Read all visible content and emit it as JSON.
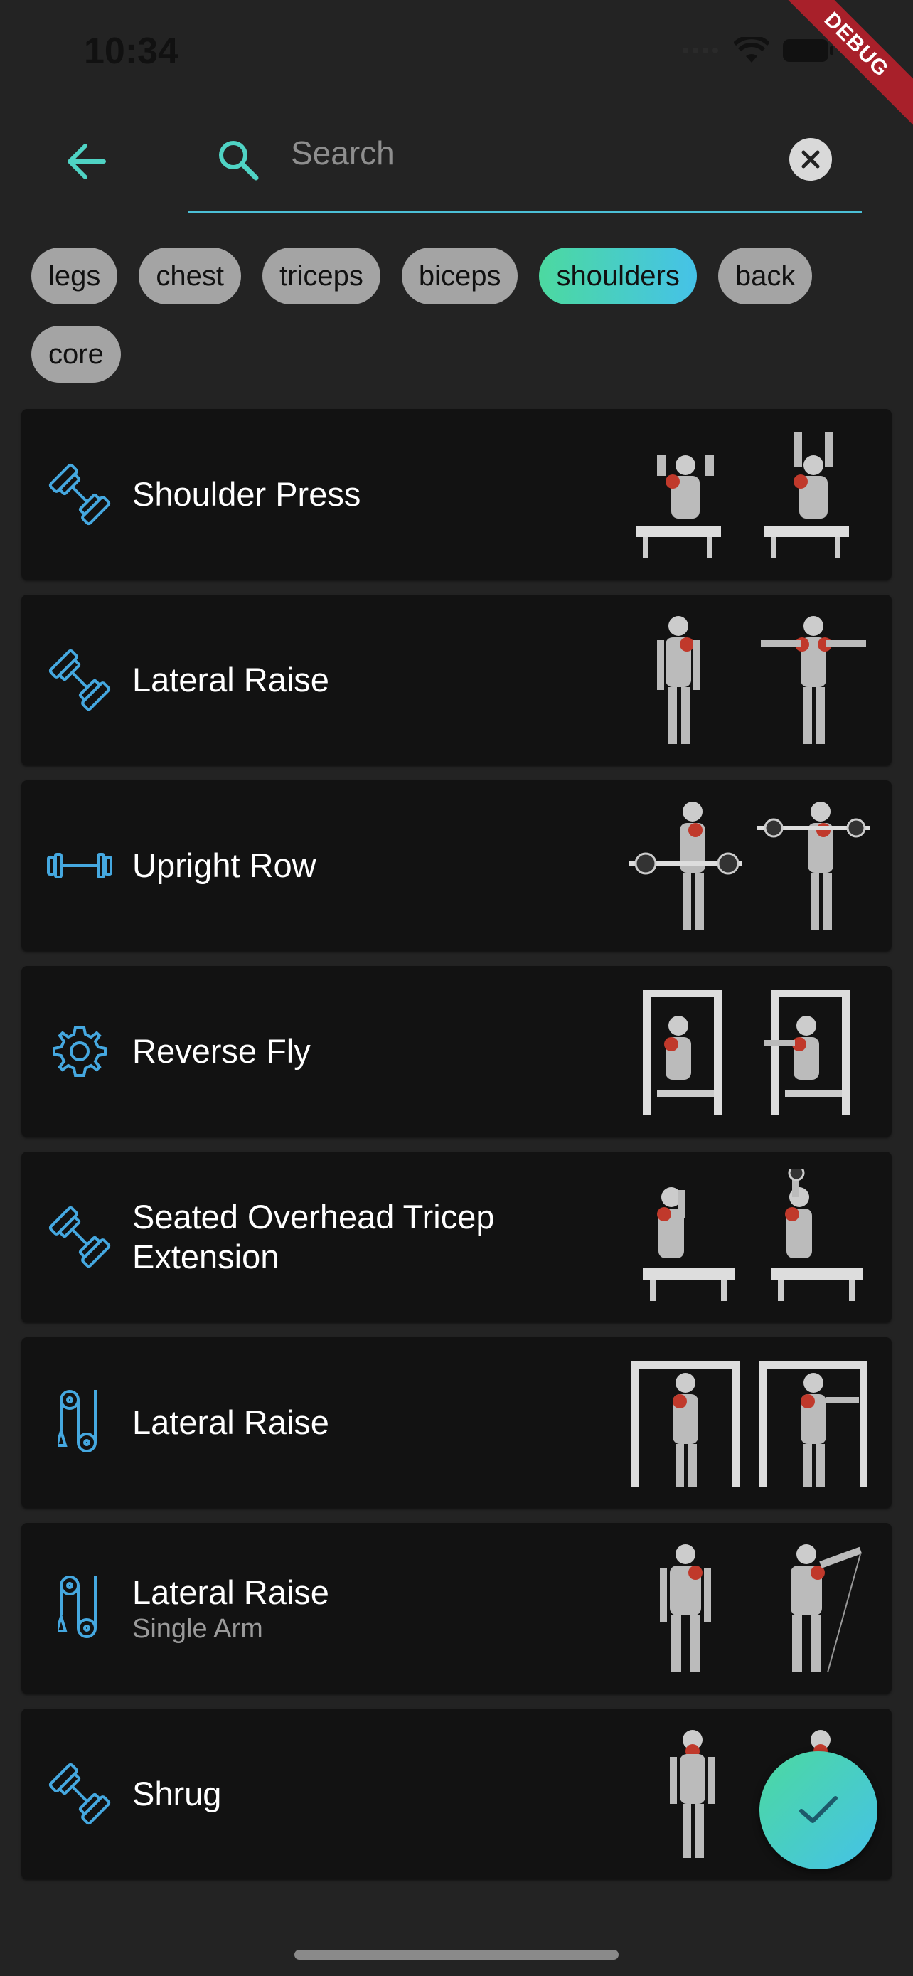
{
  "status_bar": {
    "time": "10:34",
    "debug_label": "DEBUG"
  },
  "search": {
    "placeholder": "Search"
  },
  "filters": [
    {
      "label": "legs",
      "active": false
    },
    {
      "label": "chest",
      "active": false
    },
    {
      "label": "triceps",
      "active": false
    },
    {
      "label": "biceps",
      "active": false
    },
    {
      "label": "shoulders",
      "active": true
    },
    {
      "label": "back",
      "active": false
    },
    {
      "label": "core",
      "active": false
    }
  ],
  "exercises": [
    {
      "title": "Shoulder Press",
      "subtitle": "",
      "icon": "dumbbell-icon"
    },
    {
      "title": "Lateral Raise",
      "subtitle": "",
      "icon": "dumbbell-icon"
    },
    {
      "title": "Upright Row",
      "subtitle": "",
      "icon": "barbell-icon"
    },
    {
      "title": "Reverse Fly",
      "subtitle": "",
      "icon": "machine-gear-icon"
    },
    {
      "title": "Seated Overhead Tricep Extension",
      "subtitle": "",
      "icon": "dumbbell-icon"
    },
    {
      "title": "Lateral Raise",
      "subtitle": "",
      "icon": "cable-icon"
    },
    {
      "title": "Lateral Raise",
      "subtitle": "Single Arm",
      "icon": "cable-icon"
    },
    {
      "title": "Shrug",
      "subtitle": "",
      "icon": "dumbbell-icon"
    }
  ],
  "colors": {
    "accent": "#45c2e8",
    "accent_green": "#4cd9a0",
    "background": "#232323",
    "card": "#121212",
    "muscle": "#c0392b"
  }
}
